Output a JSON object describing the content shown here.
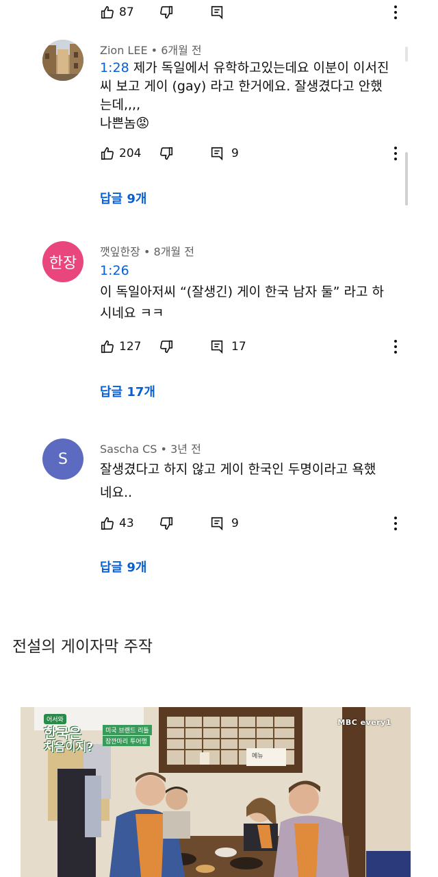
{
  "top_actions": {
    "likes": "87"
  },
  "comments": [
    {
      "author": "Zion LEE",
      "age": "6개월 전",
      "timestamp": "1:28",
      "lines": [
        " 제가 독일에서 유학하고있는데요 이분이 이서진",
        "씨 보고 게이 (gay) 라고 한거에요. 잘생겼다고 안했",
        "는데,,,,",
        "나쁜놈"
      ],
      "emoji": "😡",
      "likes": "204",
      "replies_count": "9",
      "replies_link": "답글 9개"
    },
    {
      "author": "깻잎한장",
      "age": "8개월 전",
      "avatar_text": "한장",
      "timestamp": "1:26",
      "lines": [
        "이 독일아저씨 “(잘생긴) 게이 한국 남자 둘” 라고 하",
        "시네요 ㅋㅋ"
      ],
      "likes": "127",
      "replies_count": "17",
      "replies_link": "답글 17개"
    },
    {
      "author": "Sascha CS",
      "age": "3년 전",
      "avatar_text": "S",
      "lines": [
        "잘생겼다고 하지 않고 게이 한국인 두명이라고 욕했",
        "네요.."
      ],
      "likes": "43",
      "replies_count": "9",
      "replies_link": "답글 9개"
    }
  ],
  "separator": "•",
  "caption": "전설의 게이자막 주작",
  "video": {
    "program_badge": "어서와",
    "program_title_1": "한국은",
    "program_title_2": "처음이지?",
    "subtitle_1": "미국 브랜드 리틀",
    "subtitle_2": "잠깐마리 투어행",
    "channel_logo": "MBC every1",
    "poster_text": "메뉴"
  },
  "colors": {
    "link_blue": "#065fd4",
    "avatar_pink": "#e8467c",
    "avatar_blue": "#5c6bc0"
  }
}
